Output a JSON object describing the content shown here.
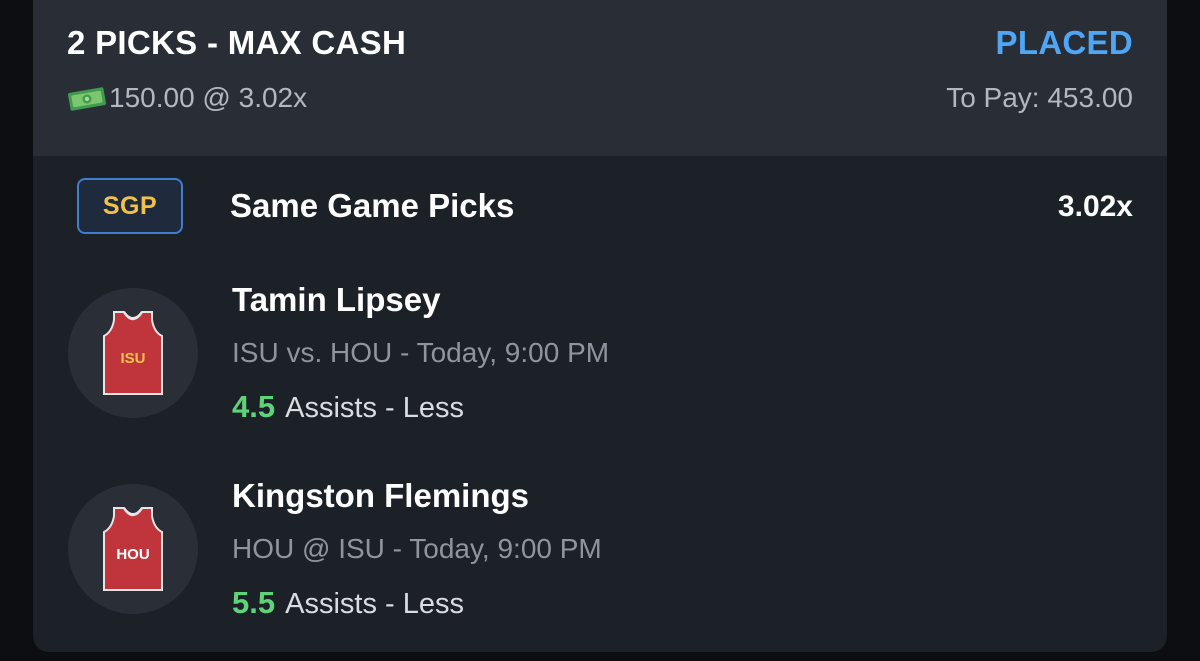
{
  "entry": {
    "title": "2 PICKS - MAX CASH",
    "status": "PLACED",
    "stake_text": "150.00 @ 3.02x",
    "to_pay": "To Pay: 453.00",
    "cash_icon": "money-bill-icon"
  },
  "colors": {
    "status": "#4fa6f5",
    "line_value": "#5fd37a",
    "sgp_text": "#f2c14a",
    "sgp_border": "#3f7fd0",
    "jersey": "#c0353c"
  },
  "sgp": {
    "badge": "SGP",
    "label": "Same Game Picks",
    "multiplier": "3.02x"
  },
  "picks": [
    {
      "player": "Tamin Lipsey",
      "jersey_text": "ISU",
      "jersey_text_color": "#f2c14a",
      "game": "ISU vs. HOU",
      "time": "- Today, 9:00 PM",
      "line": "4.5",
      "stat": "Assists - Less"
    },
    {
      "player": "Kingston Flemings",
      "jersey_text": "HOU",
      "jersey_text_color": "#ffffff",
      "game": "HOU @ ISU",
      "time": "- Today, 9:00 PM",
      "line": "5.5",
      "stat": "Assists - Less"
    }
  ]
}
